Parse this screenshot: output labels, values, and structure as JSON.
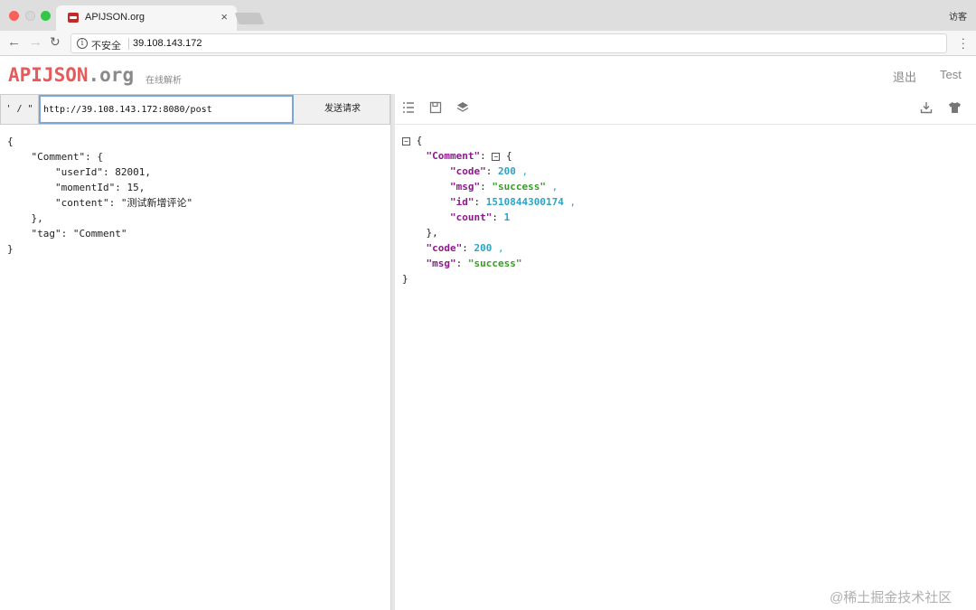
{
  "browser": {
    "tab_title": "APIJSON.org",
    "tab_close": "×",
    "visitor_label": "访客",
    "insecure_label": "不安全",
    "url": "39.108.143.172"
  },
  "app": {
    "logo_main": "APIJSON",
    "logo_org": ".org",
    "subtitle": "在线解析",
    "logout": "退出",
    "test": "Test"
  },
  "request": {
    "quote_toggle": "' / \"",
    "url": "http://39.108.143.172:8080/post",
    "send": "发送请求",
    "body": "{\n    \"Comment\": {\n        \"userId\": 82001,\n        \"momentId\": 15,\n        \"content\": \"测试新增评论\"\n    },\n    \"tag\": \"Comment\"\n}"
  },
  "response": {
    "comment_key": "\"Comment\"",
    "code_key": "\"code\"",
    "code_val": "200",
    "msg_key": "\"msg\"",
    "msg_val": "\"success\"",
    "id_key": "\"id\"",
    "id_val": "1510844300174",
    "count_key": "\"count\"",
    "count_val": "1",
    "root_code_key": "\"code\"",
    "root_code_val": "200",
    "root_msg_key": "\"msg\"",
    "root_msg_val": "\"success\""
  },
  "watermark": "@稀土掘金技术社区",
  "colors": {
    "logo": "#e55b5b",
    "json_key": "#8b1a8b",
    "json_number": "#2aa4c8",
    "json_string": "#3a9a2a",
    "input_focus": "#7aa6d8"
  }
}
